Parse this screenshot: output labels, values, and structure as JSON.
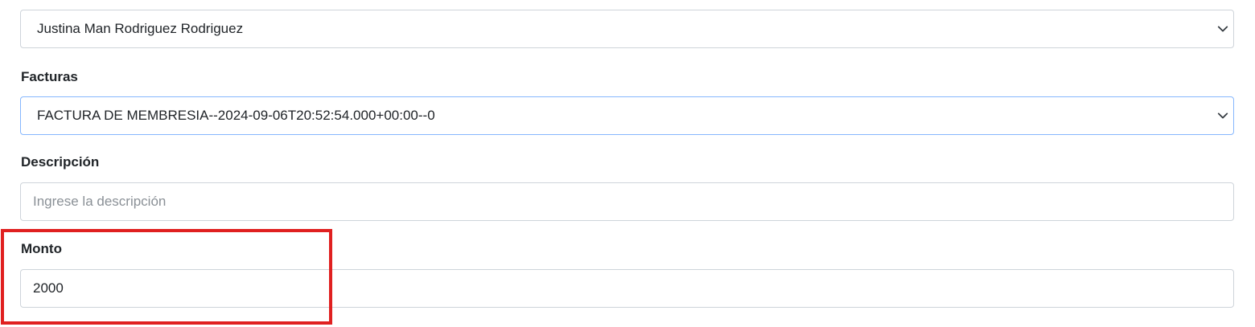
{
  "cliente": {
    "selected": "Justina Man Rodriguez Rodriguez"
  },
  "facturas": {
    "label": "Facturas",
    "selected": "FACTURA DE MEMBRESIA--2024-09-06T20:52:54.000+00:00--0"
  },
  "descripcion": {
    "label": "Descripción",
    "placeholder": "Ingrese la descripción",
    "value": ""
  },
  "monto": {
    "label": "Monto",
    "value": "2000"
  },
  "highlight": {
    "color": "#e02020"
  },
  "icons": {
    "select_chevron": "chevron-down-icon"
  }
}
